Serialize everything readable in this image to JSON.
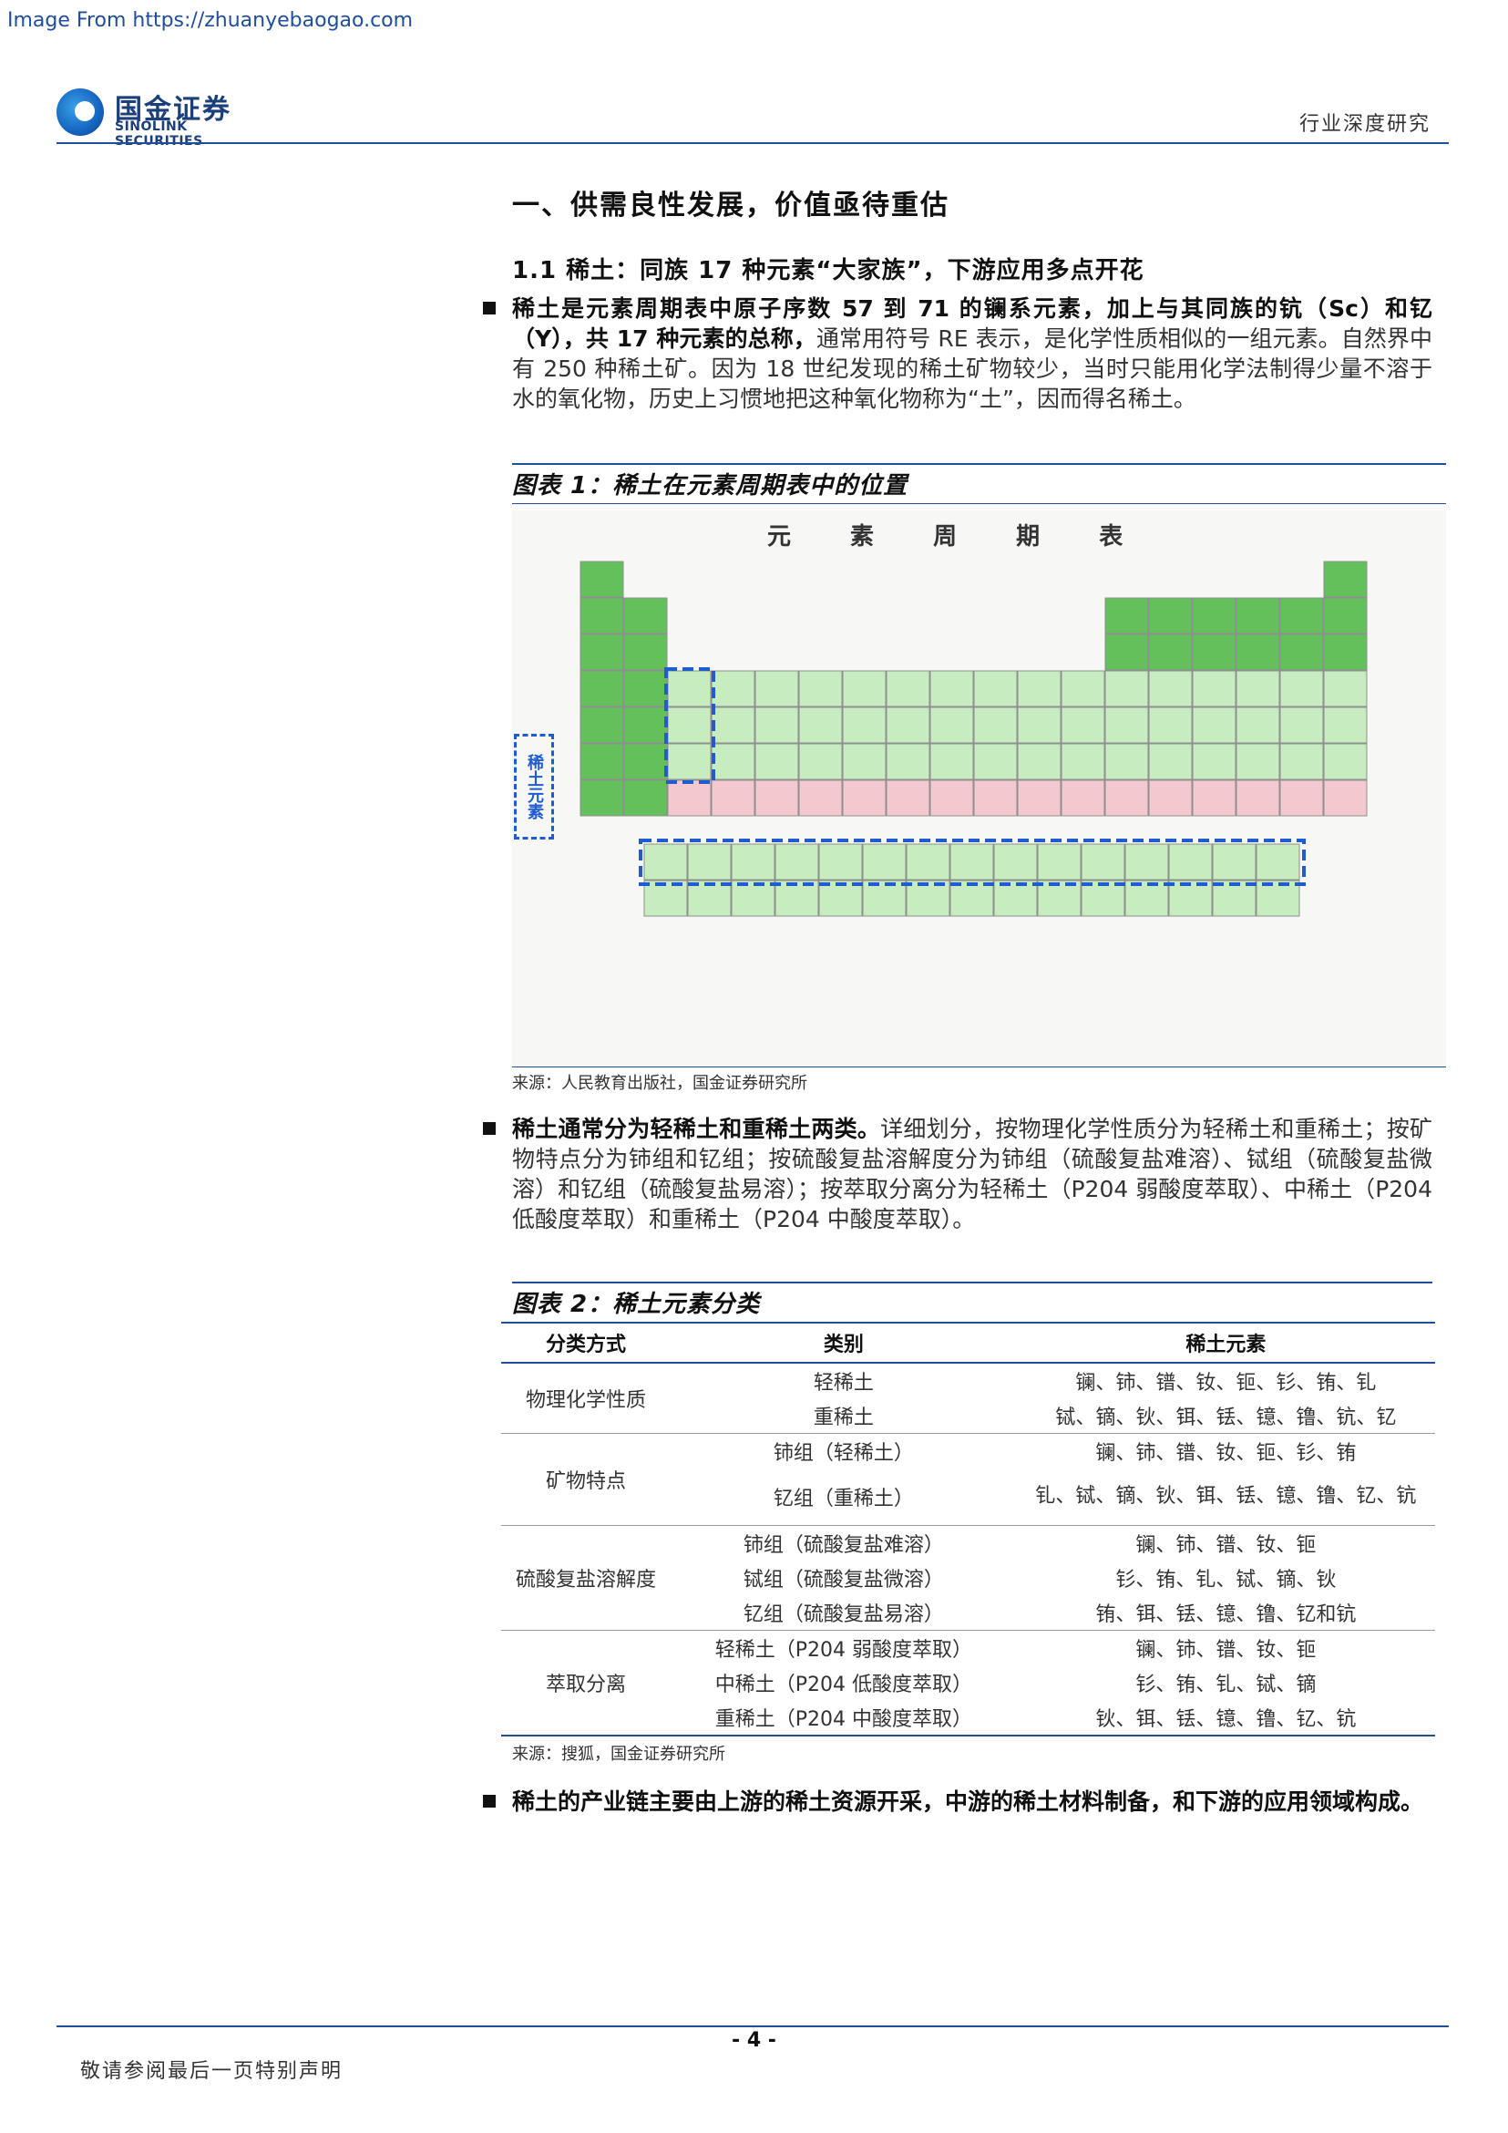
{
  "source_note": "Image From https://zhuanyebaogao.com",
  "header": {
    "logo_cn": "国金证券",
    "logo_en": "SINOLINK SECURITIES",
    "report_type": "行业深度研究"
  },
  "section": {
    "h1": "一、供需良性发展，价值亟待重估",
    "h2": "1.1 稀土：同族 17 种元素“大家族”，下游应用多点开花"
  },
  "paragraphs": {
    "p1_lead": "稀土是元素周期表中原子序数 57 到 71 的镧系元素，加上与其同族的钪（Sc）和钇（Y），共 17 种元素的总称，",
    "p1_rest": "通常用符号 RE 表示，是化学性质相似的一组元素。自然界中有 250 种稀土矿。因为 18 世纪发现的稀土矿物较少，当时只能用化学法制得少量不溶于水的氧化物，历史上习惯地把这种氧化物称为“土”，因而得名稀土。",
    "p2_lead": "稀土通常分为轻稀土和重稀土两类。",
    "p2_rest": "详细划分，按物理化学性质分为轻稀土和重稀土；按矿物特点分为铈组和钇组；按硫酸复盐溶解度分为铈组（硫酸复盐难溶）、铽组（硫酸复盐微溶）和钇组（硫酸复盐易溶）；按萃取分离分为轻稀土（P204 弱酸度萃取）、中稀土（P204 低酸度萃取）和重稀土（P204 中酸度萃取）。",
    "p3_lead": "稀土的产业链主要由上游的稀土资源开采，中游的稀土材料制备，和下游的应用领域构成。"
  },
  "figure1": {
    "title": "图表 1：稀土在元素周期表中的位置",
    "table_title": "元 素 周 期 表",
    "side_label": "稀土元素",
    "source": "来源：人民教育出版社，国金证券研究所"
  },
  "figure2": {
    "title": "图表 2：稀土元素分类",
    "headers": [
      "分类方式",
      "类别",
      "稀土元素"
    ],
    "rows": [
      {
        "method": "物理化学性质",
        "category": "轻稀土",
        "elements": "镧、铈、镨、钕、钷、钐、铕、钆"
      },
      {
        "method": "",
        "category": "重稀土",
        "elements": "铽、镝、钬、铒、铥、镱、镥、钪、钇"
      },
      {
        "method": "矿物特点",
        "category": "铈组（轻稀土）",
        "elements": "镧、铈、镨、钕、钷、钐、铕"
      },
      {
        "method": "",
        "category": "钇组（重稀土）",
        "elements": "钆、铽、镝、钬、铒、铥、镱、镥、钇、钪"
      },
      {
        "method": "硫酸复盐溶解度",
        "category": "铈组（硫酸复盐难溶）",
        "elements": "镧、铈、镨、钕、钷"
      },
      {
        "method": "",
        "category": "铽组（硫酸复盐微溶）",
        "elements": "钐、铕、钆、铽、镝、钬"
      },
      {
        "method": "",
        "category": "钇组（硫酸复盐易溶）",
        "elements": "铕、铒、铥、镱、镥、钇和钪"
      },
      {
        "method": "萃取分离",
        "category": "轻稀土（P204 弱酸度萃取）",
        "elements": "镧、铈、镨、钕、钷"
      },
      {
        "method": "",
        "category": "中稀土（P204 低酸度萃取）",
        "elements": "钐、铕、钆、铽、镝"
      },
      {
        "method": "",
        "category": "重稀土（P204 中酸度萃取）",
        "elements": "钬、铒、铥、镱、镥、钇、钪"
      }
    ],
    "source": "来源：搜狐，国金证券研究所"
  },
  "footer": {
    "page_number": "- 4 -",
    "disclaimer": "敬请参阅最后一页特别声明"
  },
  "colors": {
    "brand_blue": "#1f4e9c",
    "pt_green": "#64c05a",
    "pt_light_green": "#c6ecbf",
    "pt_pink": "#f3c8cf",
    "rare_earth_highlight": "#1f5bd1"
  }
}
